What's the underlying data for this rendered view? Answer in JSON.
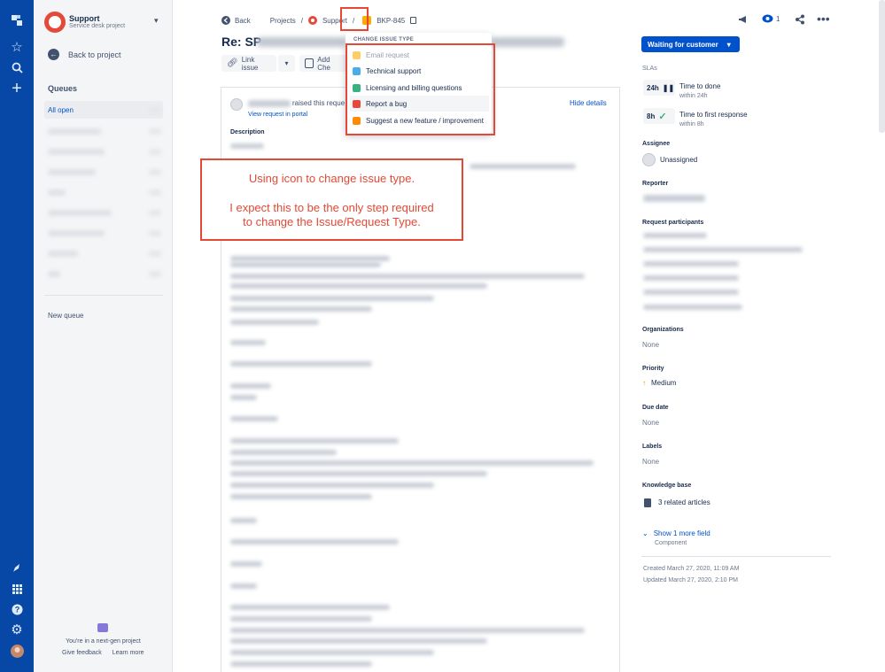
{
  "global_nav": {
    "icons": [
      "jira-logo-icon",
      "star-icon",
      "search-icon",
      "plus-icon",
      "rocket-icon",
      "apps-icon",
      "help-icon",
      "gear-icon",
      "user-avatar"
    ]
  },
  "sidebar": {
    "project_name": "Support",
    "project_type": "Service desk project",
    "back_label": "Back to project",
    "queues_heading": "Queues",
    "active_queue": "All open",
    "new_queue": "New queue",
    "nextgen_text": "You're in a next-gen project",
    "give_feedback": "Give feedback",
    "learn_more": "Learn more"
  },
  "breadcrumb": {
    "back": "Back",
    "projects": "Projects",
    "sep": "/",
    "project": "Support",
    "issue_key": "BKP-845"
  },
  "header": {
    "title_prefix": "Re: SP",
    "watch_count": "1"
  },
  "toolbar": {
    "link_issue": "Link issue",
    "add_checklist": "Add Che"
  },
  "activity": {
    "raised": "raised this reque",
    "view_portal": "View request in portal",
    "hide_details": "Hide details",
    "description_heading": "Description"
  },
  "dropdown": {
    "heading": "CHANGE ISSUE TYPE",
    "items": [
      {
        "label": "Email request",
        "color": "#ffab00",
        "disabled": true
      },
      {
        "label": "Technical support",
        "color": "#4bade8",
        "disabled": false
      },
      {
        "label": "Licensing and billing questions",
        "color": "#36b37e",
        "disabled": false
      },
      {
        "label": "Report a bug",
        "color": "#e5493a",
        "disabled": false
      },
      {
        "label": "Suggest a new feature / improvement",
        "color": "#ff8b00",
        "disabled": false
      }
    ]
  },
  "annotation": {
    "line1": "Using icon to change issue type.",
    "line2": "I expect this to be the only step required",
    "line3": "to change the Issue/Request Type."
  },
  "right_panel": {
    "status": "Waiting for customer",
    "slas_heading": "SLAs",
    "sla1_time": "24h",
    "sla1_label": "Time to done",
    "sla1_sub": "within 24h",
    "sla2_time": "8h",
    "sla2_label": "Time to first response",
    "sla2_sub": "within 8h",
    "assignee_heading": "Assignee",
    "assignee": "Unassigned",
    "reporter_heading": "Reporter",
    "participants_heading": "Request participants",
    "organizations_heading": "Organizations",
    "organizations": "None",
    "priority_heading": "Priority",
    "priority": "Medium",
    "due_heading": "Due date",
    "due": "None",
    "labels_heading": "Labels",
    "labels": "None",
    "kb_heading": "Knowledge base",
    "kb": "3 related articles",
    "show_more": "Show 1 more field",
    "show_more_sub": "Component",
    "created": "Created March 27, 2020, 11:09 AM",
    "updated": "Updated March 27, 2020, 2:10 PM"
  },
  "colors": {
    "nav": "#0747a6",
    "accent": "#0052cc",
    "annotation": "#e34935"
  }
}
